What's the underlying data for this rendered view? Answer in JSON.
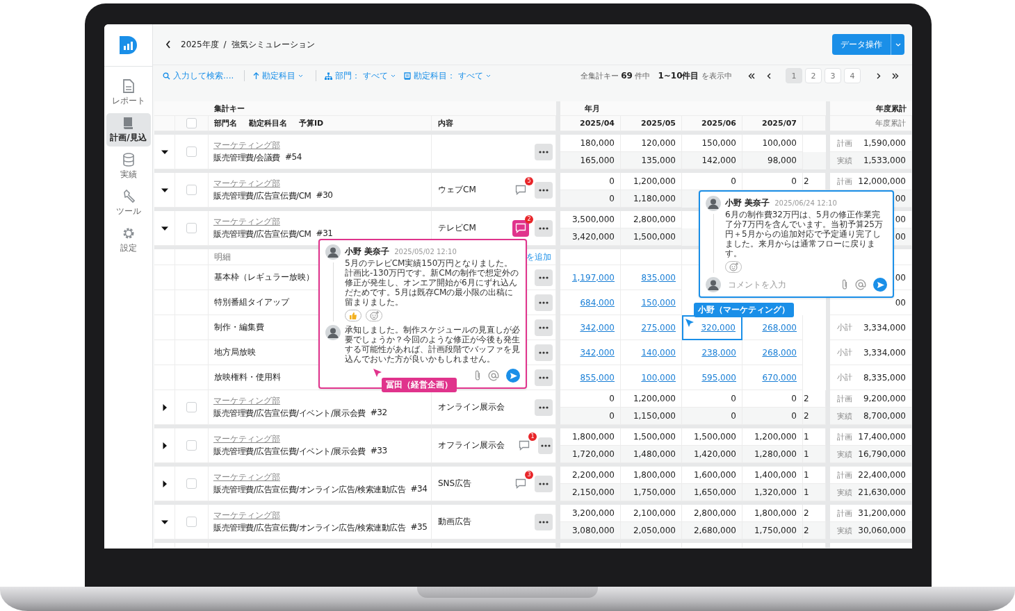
{
  "sidebar": {
    "items": [
      {
        "label": "レポート",
        "selected": false
      },
      {
        "label": "計画/見込",
        "selected": true
      },
      {
        "label": "実績",
        "selected": false
      },
      {
        "label": "ツール",
        "selected": false
      },
      {
        "label": "設定",
        "selected": false
      }
    ]
  },
  "breadcrumb": {
    "items": [
      "2025年度",
      "強気シミュレーション"
    ],
    "separator": "/"
  },
  "primary_button": {
    "label": "データ操作"
  },
  "toolbar": {
    "search": {
      "placeholder": "入力して検索...."
    },
    "sort": {
      "label": "勘定科目"
    },
    "filters": [
      {
        "kind": "department",
        "label": "部門：",
        "value": "すべて"
      },
      {
        "kind": "account",
        "label": "勘定科目：",
        "value": "すべて"
      }
    ],
    "summary": "全集計キー **69** 件中　**1~10件目** を表示中",
    "pages": [
      {
        "label": "1",
        "selected": true
      },
      {
        "label": "2",
        "selected": false
      },
      {
        "label": "3",
        "selected": false
      },
      {
        "label": "4",
        "selected": false
      }
    ]
  },
  "table": {
    "group_headers": {
      "key": "集計キー",
      "months": "年月",
      "total": "年度累計"
    },
    "columns": {
      "checked": false,
      "key": [
        "部門名",
        "勘定科目名",
        "予算ID"
      ],
      "content": "内容",
      "months": [
        "2025/04",
        "2025/05",
        "2025/06",
        "2025/07"
      ],
      "total": "年度累計"
    },
    "rows": [
      {
        "kind": "group",
        "expanded": true,
        "checked": false,
        "department": "マーケティング部",
        "account": "販売管理費/会議費",
        "budget_id": "#54",
        "plan": {
          "label": "計画",
          "months": [
            "180,000",
            "120,000",
            "150,000",
            "100,000"
          ],
          "total": "1,590,000"
        },
        "actual": {
          "label": "実績",
          "months": [
            "165,000",
            "135,000",
            "142,000",
            "98,000"
          ],
          "total": "1,533,000"
        }
      },
      {
        "kind": "group",
        "expanded": true,
        "checked": false,
        "department": "マーケティング部",
        "account": "販売管理費/広告宣伝費/CM",
        "budget_id": "#30",
        "content": "ウェブCM",
        "comments": {
          "count": "5",
          "active": false
        },
        "plan": {
          "label": "計画",
          "months": [
            "0",
            "1,200,000",
            "0",
            "0"
          ],
          "column_5": "2",
          "total": "12,000,000"
        },
        "actual": {
          "months": [
            "0",
            "1,180,000"
          ],
          "total": "00"
        }
      },
      {
        "kind": "group",
        "expanded": true,
        "checked": false,
        "department": "マーケティング部",
        "account": "販売管理費/広告宣伝費/CM",
        "budget_id": "#31",
        "content": "テレビCM",
        "comments": {
          "count": "2",
          "active": true
        },
        "plan": {
          "months": [
            "3,500,000",
            "2,800,000"
          ],
          "total": "00"
        },
        "actual": {
          "months": [
            "3,420,000",
            "1,500,000"
          ],
          "total": "00"
        }
      },
      {
        "kind": "detail_header",
        "label": "明細",
        "link": "を追加"
      },
      {
        "kind": "detail",
        "name": "基本枠（レギュラー放映）",
        "months": [
          {
            "value": "1,197,000",
            "selected": false
          },
          {
            "value": "835,000",
            "selected": false
          }
        ],
        "total": {
          "value": "00"
        }
      },
      {
        "kind": "detail",
        "name": "特別番組タイアップ",
        "months": [
          {
            "value": "684,000",
            "selected": false
          },
          {
            "value": "150,000",
            "selected": false
          }
        ],
        "total": {
          "value": "00"
        }
      },
      {
        "kind": "detail",
        "name": "制作・編集費",
        "months": [
          {
            "value": "342,000",
            "selected": false
          },
          {
            "value": "275,000",
            "selected": false
          },
          {
            "value": "320,000",
            "selected": true
          },
          {
            "value": "268,000",
            "selected": false
          }
        ],
        "total": {
          "label": "小計",
          "value": "3,334,000"
        }
      },
      {
        "kind": "detail",
        "name": "地方局放映",
        "months": [
          {
            "value": "342,000",
            "selected": false
          },
          {
            "value": "140,000",
            "selected": false
          },
          {
            "value": "238,000",
            "selected": false
          },
          {
            "value": "268,000",
            "selected": false
          }
        ],
        "total": {
          "label": "小計",
          "value": "3,334,000"
        }
      },
      {
        "kind": "detail",
        "name": "放映権料・使用料",
        "months": [
          {
            "value": "855,000",
            "selected": false
          },
          {
            "value": "100,000",
            "selected": false
          },
          {
            "value": "595,000",
            "selected": false
          },
          {
            "value": "670,000",
            "selected": false
          }
        ],
        "total": {
          "label": "小計",
          "value": "8,335,000"
        }
      },
      {
        "kind": "group",
        "expanded": false,
        "checked": false,
        "department": "マーケティング部",
        "account": "販売管理費/広告宣伝費/イベント/展示会費",
        "budget_id": "#32",
        "content": "オンライン展示会",
        "plan": {
          "label": "計画",
          "months": [
            "0",
            "1,200,000",
            "0",
            "0"
          ],
          "column_5": "2",
          "total": "9,200,000"
        },
        "actual": {
          "label": "実績",
          "months": [
            "0",
            "1,150,000",
            "0",
            "0"
          ],
          "column_5": "2",
          "total": "8,700,000"
        }
      },
      {
        "kind": "group",
        "expanded": false,
        "checked": false,
        "department": "マーケティング部",
        "account": "販売管理費/広告宣伝費/イベント/展示会費",
        "budget_id": "#33",
        "content": "オフライン展示会",
        "comments": {
          "count": "1",
          "active": false
        },
        "plan": {
          "label": "計画",
          "months": [
            "1,800,000",
            "1,500,000",
            "1,500,000",
            "1,200,000"
          ],
          "column_5": "1",
          "total": "17,400,000"
        },
        "actual": {
          "label": "実績",
          "months": [
            "1,720,000",
            "1,480,000",
            "1,420,000",
            "1,280,000"
          ],
          "column_5": "1",
          "total": "16,790,000"
        }
      },
      {
        "kind": "group",
        "expanded": false,
        "checked": false,
        "department": "マーケティング部",
        "account": "販売管理費/広告宣伝費/オンライン広告/検索連動広告",
        "budget_id": "#34",
        "content": "SNS広告",
        "comments": {
          "count": "3",
          "active": false
        },
        "plan": {
          "label": "計画",
          "months": [
            "2,200,000",
            "1,800,000",
            "1,600,000",
            "1,400,000"
          ],
          "column_5": "1",
          "total": "22,400,000"
        },
        "actual": {
          "label": "実績",
          "months": [
            "2,150,000",
            "1,750,000",
            "1,650,000",
            "1,320,000"
          ],
          "column_5": "1",
          "total": "21,630,000"
        }
      },
      {
        "kind": "group",
        "expanded": true,
        "checked": false,
        "department": "マーケティング部",
        "account": "販売管理費/広告宣伝費/オンライン広告/検索連動広告",
        "budget_id": "#35",
        "content": "動画広告",
        "plan": {
          "label": "計画",
          "months": [
            "3,200,000",
            "2,100,000",
            "2,800,000",
            "1,800,000"
          ],
          "column_5": "2",
          "total": "31,200,000"
        },
        "actual": {
          "label": "実績",
          "months": [
            "3,080,000",
            "2,050,000",
            "2,680,000",
            "1,750,000"
          ],
          "column_5": "2",
          "total": "30,060,000"
        }
      }
    ]
  },
  "popups": [
    {
      "color": "#e0338c",
      "comments": [
        {
          "author": "小野 美奈子",
          "time": "2025/05/02 12:10",
          "text": "5月のテレビCM実績150万円となりました。計画比-130万円です。新CMの制作で想定外の修正が発生し、オンエア開始が6月にずれ込んだためです。5月は既存CMの最小限の出稿に留まりました。",
          "reactions": [
            {
              "kind": "like"
            }
          ]
        },
        {
          "text": "承知しました。制作スケジュールの見直しが必要でしょうか？今回のような修正が今後も発生する可能性があれば、計画段階でバッファを見込んでおいた方が良いかもしれません。"
        }
      ]
    },
    {
      "color": "#1a8fe8",
      "comments": [
        {
          "author": "小野 美奈子",
          "time": "2025/06/24 12:10",
          "text": "6月の制作費32万円は、5月の修正作業完了分7万円を含んでいます。当初予算25万円＋5月からの追加対応で予定通り完了しました。来月からは通常フローに戻ります。"
        }
      ],
      "input": {
        "placeholder": "コメントを入力"
      }
    }
  ],
  "cursors": [
    {
      "name": "冨田（経営企画）",
      "color": "#e0338c"
    },
    {
      "name": "小野（マーケティング）",
      "color": "#1a8fe8"
    }
  ]
}
